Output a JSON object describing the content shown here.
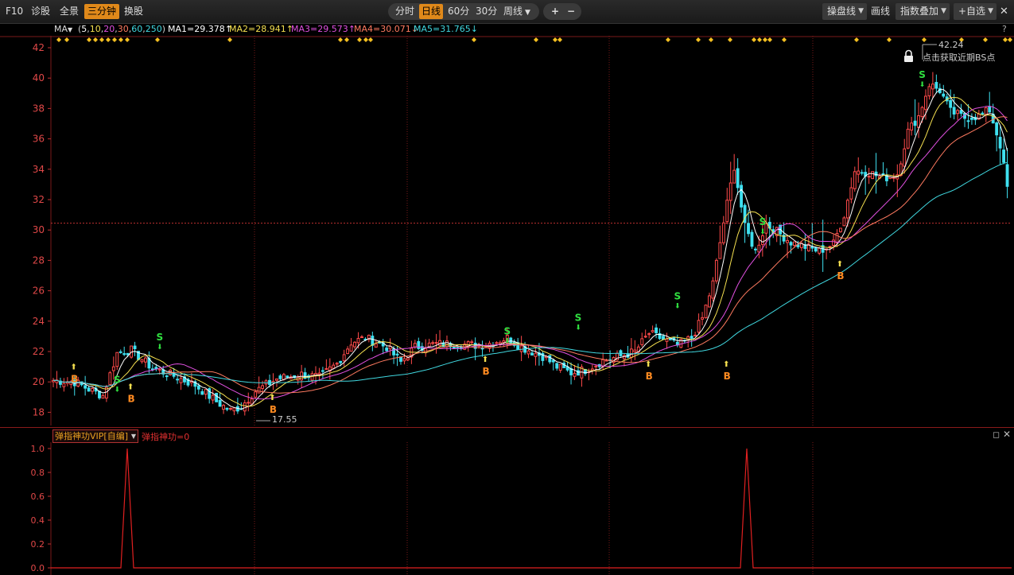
{
  "topbar": {
    "f10": "F10",
    "diagnose": "诊股",
    "panorama": "全景",
    "three_min": "三分钟",
    "switch_stock": "换股",
    "tabs": [
      "分时",
      "日线",
      "60分",
      "30分"
    ],
    "week": "周线",
    "zoom_in": "+",
    "zoom_out": "−",
    "panel_line": "操盘线",
    "draw_line": "画线",
    "index_overlay": "指数叠加",
    "add_watch": "+自选",
    "close": "✕"
  },
  "ma_bar": {
    "label": "MA",
    "params_open": "(",
    "p1": "5",
    "p2": "10",
    "p3": "20",
    "p4": "30",
    "p5": "60",
    "p6": "250",
    "params_close": ")",
    "ma1": "MA1=29.378↑",
    "ma2": "MA2=28.941↑",
    "ma3": "MA3=29.573↑",
    "ma4": "MA4=30.071↓",
    "ma5": "MA5=31.765↓",
    "help": "?"
  },
  "main_chart": {
    "y_ticks": [
      "42",
      "40",
      "38",
      "36",
      "34",
      "32",
      "30",
      "28",
      "26",
      "24",
      "22",
      "20",
      "18"
    ],
    "high_label": "42.24",
    "low_label": "17.55",
    "bs_hint": "点击获取近期BS点",
    "buy_marker": "B",
    "sell_marker": "S"
  },
  "indicator": {
    "name": "弹指神功VIP[自编]",
    "value": "弹指神功=0",
    "y_ticks": [
      "1.0",
      "0.8",
      "0.6",
      "0.4",
      "0.2",
      "0.0"
    ]
  },
  "colors": {
    "up": "#ff4a4a",
    "down": "#3fe0f0",
    "ma1": "#ffffff",
    "ma2": "#f5e050",
    "ma3": "#e050e0",
    "ma4": "#ff7a60",
    "ma5": "#40d8e0",
    "accent": "#e0891a",
    "grid": "#7a1a1a"
  }
}
